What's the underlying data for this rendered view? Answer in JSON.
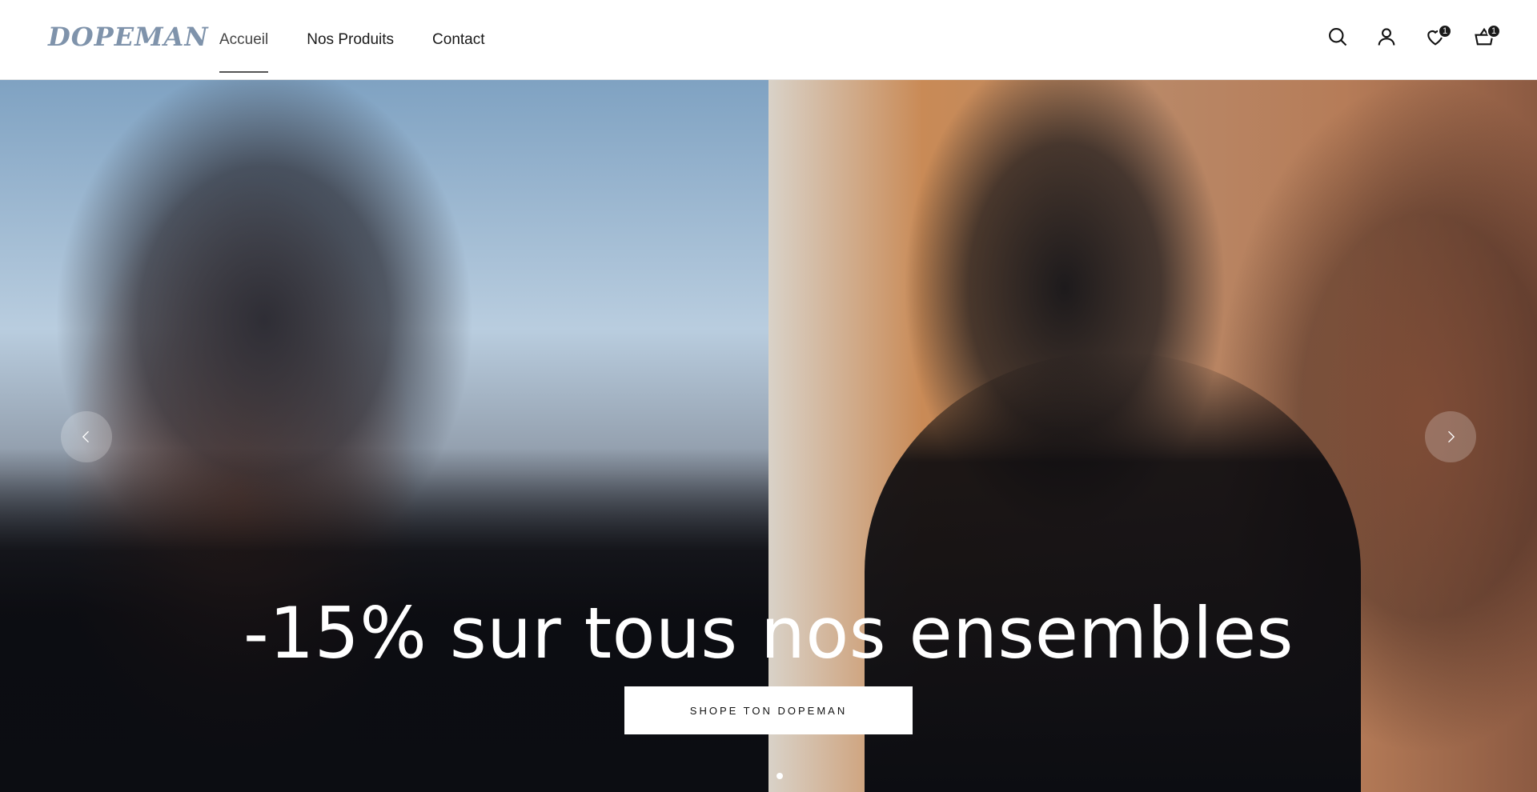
{
  "brand": {
    "logo_text": "DOPEMAN",
    "logo_color": "#7f93ab"
  },
  "nav": {
    "items": [
      {
        "label": "Accueil",
        "active": true
      },
      {
        "label": "Nos Produits",
        "active": false
      },
      {
        "label": "Contact",
        "active": false
      }
    ]
  },
  "header_icons": {
    "search": {
      "icon": "search-icon"
    },
    "account": {
      "icon": "user-icon"
    },
    "wishlist": {
      "icon": "heart-icon",
      "count": "1"
    },
    "cart": {
      "icon": "basket-icon",
      "count": "1"
    }
  },
  "hero": {
    "headline": "-15% sur tous nos ensembles",
    "cta_label": "SHOPE TON DOPEMAN",
    "slides_total": 1,
    "active_slide": 1
  }
}
